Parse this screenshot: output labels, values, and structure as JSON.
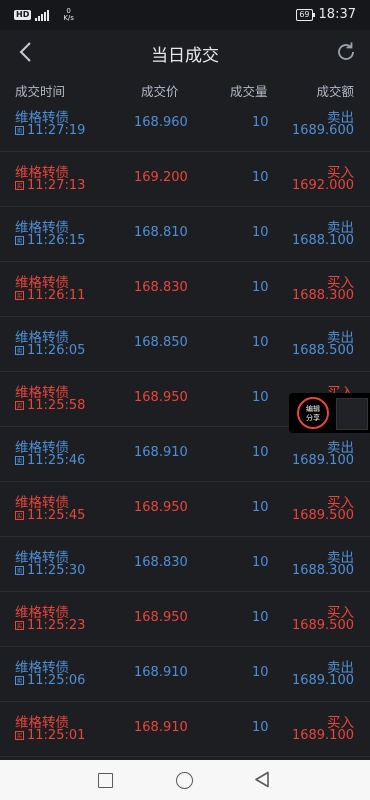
{
  "status": {
    "hd": "HD",
    "network_speed_value": "0",
    "network_speed_unit": "K/s",
    "battery": "69",
    "time": "18:37"
  },
  "header": {
    "title": "当日成交",
    "back_icon": "chevron-left-icon",
    "refresh_icon": "refresh-icon"
  },
  "columns": {
    "time": "成交时间",
    "price": "成交价",
    "volume": "成交量",
    "amount": "成交额"
  },
  "trades": [
    {
      "name": "维格转债",
      "time": "11:27:19",
      "price": "168.960",
      "volume": "10",
      "side": "卖出",
      "amount": "1689.600",
      "tag": "卖",
      "type": "sell"
    },
    {
      "name": "维格转债",
      "time": "11:27:13",
      "price": "169.200",
      "volume": "10",
      "side": "买入",
      "amount": "1692.000",
      "tag": "买",
      "type": "buy"
    },
    {
      "name": "维格转债",
      "time": "11:26:15",
      "price": "168.810",
      "volume": "10",
      "side": "卖出",
      "amount": "1688.100",
      "tag": "卖",
      "type": "sell"
    },
    {
      "name": "维格转债",
      "time": "11:26:11",
      "price": "168.830",
      "volume": "10",
      "side": "买入",
      "amount": "1688.300",
      "tag": "买",
      "type": "buy"
    },
    {
      "name": "维格转债",
      "time": "11:26:05",
      "price": "168.850",
      "volume": "10",
      "side": "卖出",
      "amount": "1688.500",
      "tag": "卖",
      "type": "sell"
    },
    {
      "name": "维格转债",
      "time": "11:25:58",
      "price": "168.950",
      "volume": "10",
      "side": "买入",
      "amount": "",
      "tag": "买",
      "type": "buy"
    },
    {
      "name": "维格转债",
      "time": "11:25:46",
      "price": "168.910",
      "volume": "10",
      "side": "卖出",
      "amount": "1689.100",
      "tag": "卖",
      "type": "sell"
    },
    {
      "name": "维格转债",
      "time": "11:25:45",
      "price": "168.950",
      "volume": "10",
      "side": "买入",
      "amount": "1689.500",
      "tag": "买",
      "type": "buy"
    },
    {
      "name": "维格转债",
      "time": "11:25:30",
      "price": "168.830",
      "volume": "10",
      "side": "卖出",
      "amount": "1688.300",
      "tag": "卖",
      "type": "sell"
    },
    {
      "name": "维格转债",
      "time": "11:25:23",
      "price": "168.950",
      "volume": "10",
      "side": "买入",
      "amount": "1689.500",
      "tag": "买",
      "type": "buy"
    },
    {
      "name": "维格转债",
      "time": "11:25:06",
      "price": "168.910",
      "volume": "10",
      "side": "卖出",
      "amount": "1689.100",
      "tag": "卖",
      "type": "sell"
    },
    {
      "name": "维格转债",
      "time": "11:25:01",
      "price": "168.910",
      "volume": "10",
      "side": "买入",
      "amount": "1689.100",
      "tag": "买",
      "type": "buy"
    }
  ],
  "floating_share": {
    "label_line1": "编辑",
    "label_line2": "分享"
  },
  "colors": {
    "sell": "#4f8fd6",
    "buy": "#e8453c",
    "background": "#1d1e22"
  },
  "navbar": {
    "icons": [
      "recent-apps-square-icon",
      "home-circle-icon",
      "back-triangle-icon"
    ]
  }
}
